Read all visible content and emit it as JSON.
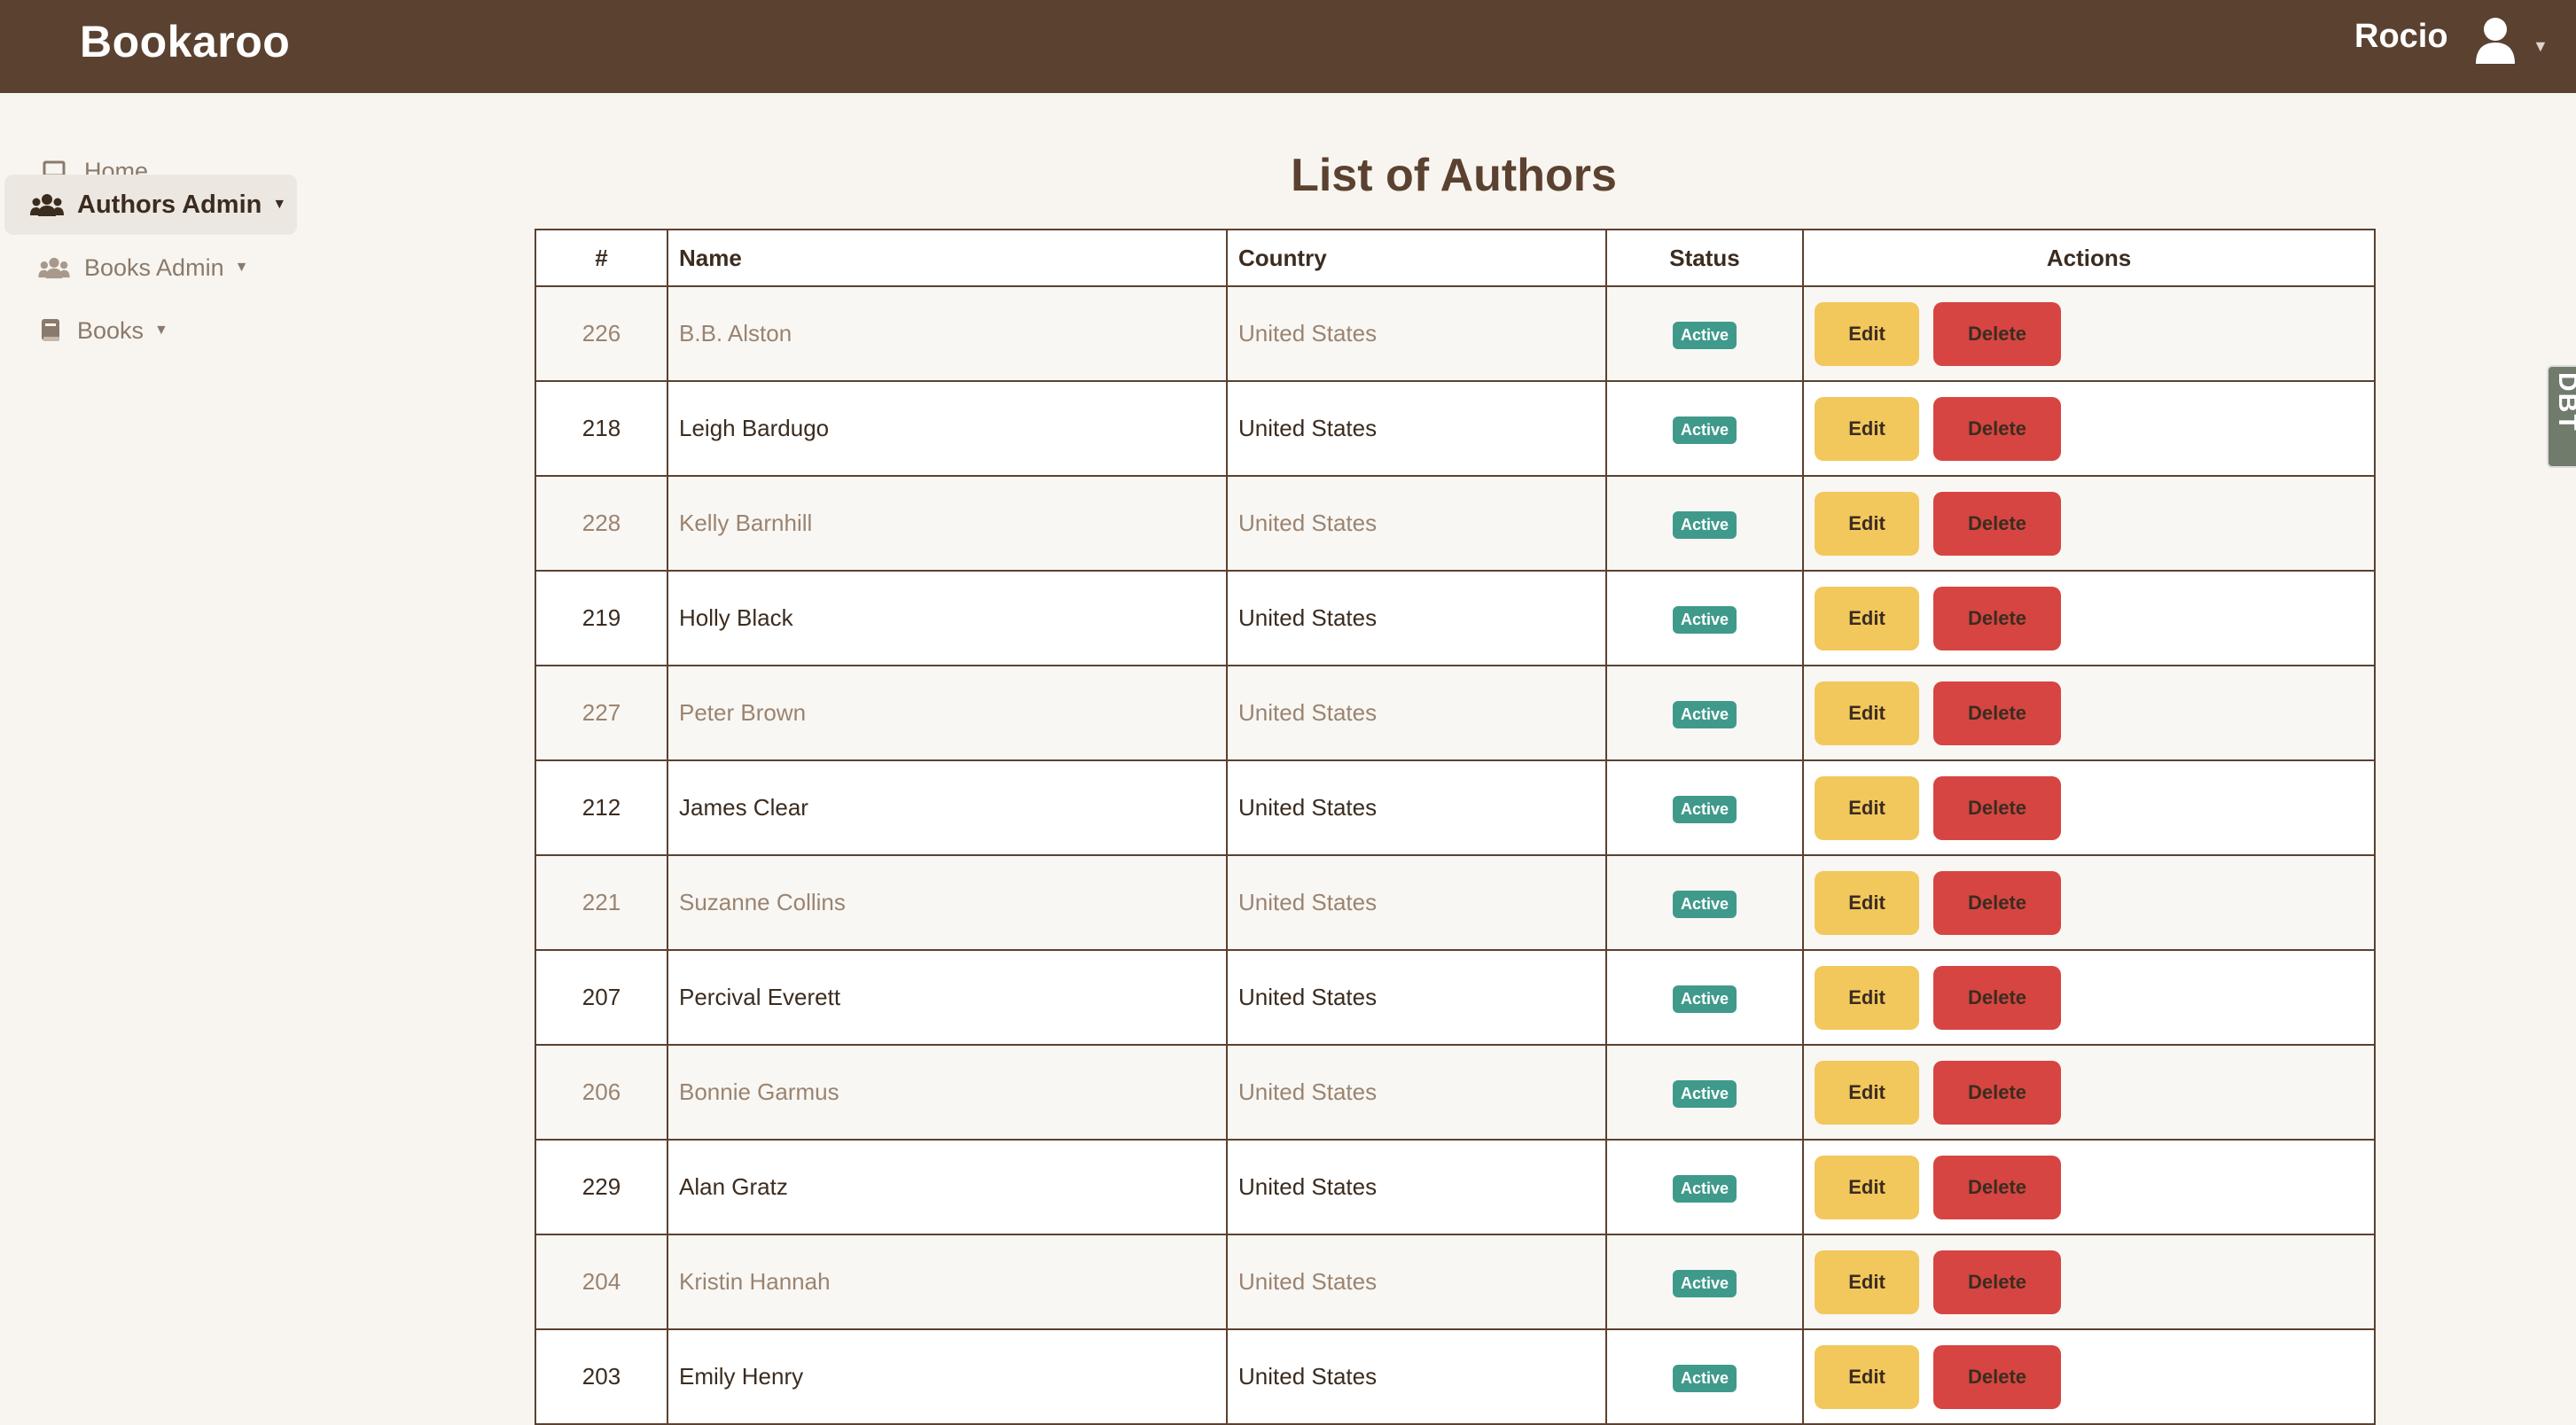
{
  "app": {
    "brand": "Bookaroo"
  },
  "user": {
    "name": "Rocio"
  },
  "sidebar": {
    "items": [
      {
        "label": "Home",
        "icon": "laptop-icon",
        "active": false,
        "dropdown": false
      },
      {
        "label": "Authors Admin",
        "icon": "users-icon",
        "active": true,
        "dropdown": true
      },
      {
        "label": "Books Admin",
        "icon": "users-icon",
        "active": false,
        "dropdown": true
      },
      {
        "label": "Books",
        "icon": "book-icon",
        "active": false,
        "dropdown": true
      }
    ]
  },
  "page": {
    "title": "List of Authors"
  },
  "table": {
    "headers": {
      "num": "#",
      "name": "Name",
      "country": "Country",
      "status": "Status",
      "actions": "Actions"
    },
    "rows": [
      {
        "id": "226",
        "name": "B.B. Alston",
        "country": "United States",
        "status": "Active"
      },
      {
        "id": "218",
        "name": "Leigh Bardugo",
        "country": "United States",
        "status": "Active"
      },
      {
        "id": "228",
        "name": "Kelly Barnhill",
        "country": "United States",
        "status": "Active"
      },
      {
        "id": "219",
        "name": "Holly Black",
        "country": "United States",
        "status": "Active"
      },
      {
        "id": "227",
        "name": "Peter Brown",
        "country": "United States",
        "status": "Active"
      },
      {
        "id": "212",
        "name": "James Clear",
        "country": "United States",
        "status": "Active"
      },
      {
        "id": "221",
        "name": "Suzanne Collins",
        "country": "United States",
        "status": "Active"
      },
      {
        "id": "207",
        "name": "Percival Everett",
        "country": "United States",
        "status": "Active"
      },
      {
        "id": "206",
        "name": "Bonnie Garmus",
        "country": "United States",
        "status": "Active"
      },
      {
        "id": "229",
        "name": "Alan Gratz",
        "country": "United States",
        "status": "Active"
      },
      {
        "id": "204",
        "name": "Kristin Hannah",
        "country": "United States",
        "status": "Active"
      },
      {
        "id": "203",
        "name": "Emily Henry",
        "country": "United States",
        "status": "Active"
      }
    ],
    "actions": {
      "edit": "Edit",
      "delete": "Delete"
    }
  },
  "side_tab": {
    "label": "DBT"
  },
  "colors": {
    "navbar": "#5b4130",
    "badge": "#3f9a8b",
    "edit_button": "#f2c75c",
    "delete_button": "#d64541"
  }
}
